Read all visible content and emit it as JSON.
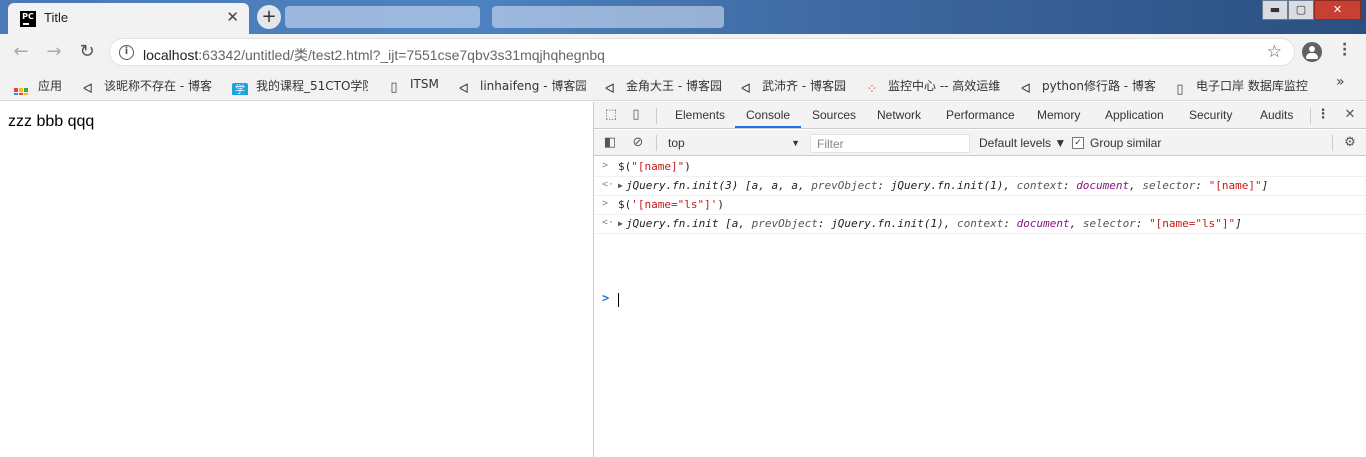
{
  "tab": {
    "favicon": "PC",
    "title": "Title",
    "close": "✕"
  },
  "new_tab": "+",
  "window": {
    "minimize": "▬",
    "maximize": "▢",
    "close": "✕"
  },
  "nav": {
    "back": "←",
    "forward": "→",
    "reload": "↻"
  },
  "address": {
    "host": "localhost",
    "rest": ":63342/untitled/类/test2.html?_ijt=7551cse7qbv3s31mqjhqhegnbq"
  },
  "bookmarks": {
    "apps_label": "应用",
    "items": [
      {
        "label": "该昵称不存在 - 博客",
        "icon": "cnblogs-icon"
      },
      {
        "label": "我的课程_51CTO学院",
        "icon": "51cto-icon"
      },
      {
        "label": "ITSM",
        "icon": "page-icon"
      },
      {
        "label": "linhaifeng - 博客园",
        "icon": "cnblogs-icon"
      },
      {
        "label": "金角大王 - 博客园",
        "icon": "cnblogs-icon"
      },
      {
        "label": "武沛齐 - 博客园",
        "icon": "cnblogs-icon"
      },
      {
        "label": "监控中心 -- 高效运维",
        "icon": "loading-icon"
      },
      {
        "label": "python修行路 - 博客",
        "icon": "cnblogs-icon"
      },
      {
        "label": "电子口岸 数据库监控",
        "icon": "page-icon"
      }
    ],
    "more": "»"
  },
  "page": {
    "body_text": "zzz bbb qqq"
  },
  "devtools": {
    "tabs": [
      "Elements",
      "Console",
      "Sources",
      "Network",
      "Performance",
      "Memory",
      "Application",
      "Security",
      "Audits"
    ],
    "active_tab": "Console",
    "context": "top",
    "filter_placeholder": "Filter",
    "levels": "Default levels ▼",
    "group_similar": "Group similar",
    "console": [
      {
        "type": "input",
        "prefix": ">",
        "parts": [
          [
            "plain",
            "$("
          ],
          [
            "str",
            "\"[name]\""
          ],
          [
            "plain",
            ")"
          ]
        ]
      },
      {
        "type": "output",
        "prefix": "<·",
        "parts": [
          [
            "tri",
            "▶"
          ],
          [
            "italic",
            "jQuery.fn.init(3) [a, a, a, "
          ],
          [
            "italic-prop",
            "prevObject"
          ],
          [
            "italic",
            ": jQuery.fn.init(1), "
          ],
          [
            "italic-prop",
            "context"
          ],
          [
            "italic",
            ": "
          ],
          [
            "kw",
            "document"
          ],
          [
            "italic",
            ", "
          ],
          [
            "italic-prop",
            "selector"
          ],
          [
            "italic",
            ": "
          ],
          [
            "str",
            "\"[name]\""
          ],
          [
            "italic",
            "]"
          ]
        ]
      },
      {
        "type": "input",
        "prefix": ">",
        "parts": [
          [
            "plain",
            "$("
          ],
          [
            "str",
            "'[name=\"ls\"]'"
          ],
          [
            "plain",
            ")"
          ]
        ]
      },
      {
        "type": "output",
        "prefix": "<·",
        "parts": [
          [
            "tri",
            "▶"
          ],
          [
            "italic",
            "jQuery.fn.init [a, "
          ],
          [
            "italic-prop",
            "prevObject"
          ],
          [
            "italic",
            ": jQuery.fn.init(1), "
          ],
          [
            "italic-prop",
            "context"
          ],
          [
            "italic",
            ": "
          ],
          [
            "kw",
            "document"
          ],
          [
            "italic",
            ", "
          ],
          [
            "italic-prop",
            "selector"
          ],
          [
            "italic",
            ": "
          ],
          [
            "str",
            "\"[name=\"ls\"]\""
          ],
          [
            "italic",
            "]"
          ]
        ]
      }
    ],
    "prompt": ">"
  }
}
